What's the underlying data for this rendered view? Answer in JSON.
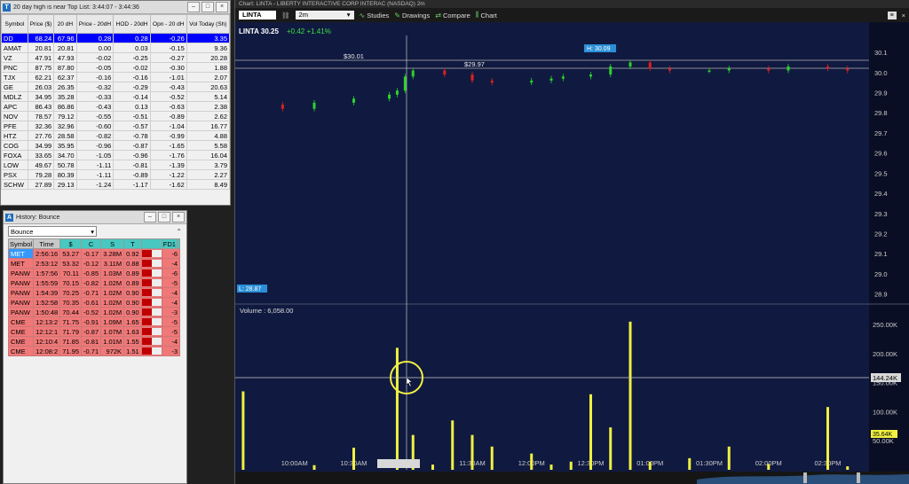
{
  "toplist": {
    "title": "20 day high is near Top List: 3:44:07 - 3:44:36",
    "icon": "T",
    "columns": [
      "Symbol",
      "Price ($)",
      "20 dH",
      "Price - 20dH",
      "HOD - 20dH",
      "Opn - 20 dH",
      "Vol Today (Sh)"
    ],
    "rows": [
      [
        "DD",
        "68.24",
        "67.96",
        "0.28",
        "0.28",
        "-0.26",
        "3.35"
      ],
      [
        "AMAT",
        "20.81",
        "20.81",
        "0.00",
        "0.03",
        "-0.15",
        "9.36"
      ],
      [
        "VZ",
        "47.91",
        "47.93",
        "-0.02",
        "-0.25",
        "-0.27",
        "20.28"
      ],
      [
        "PNC",
        "87.75",
        "87.80",
        "-0.05",
        "-0.02",
        "-0.30",
        "1.88"
      ],
      [
        "TJX",
        "62.21",
        "62.37",
        "-0.16",
        "-0.16",
        "-1.01",
        "2.07"
      ],
      [
        "GE",
        "26.03",
        "26.35",
        "-0.32",
        "-0.29",
        "-0.43",
        "20.63"
      ],
      [
        "MDLZ",
        "34.95",
        "35.28",
        "-0.33",
        "-0.14",
        "-0.52",
        "5.14"
      ],
      [
        "APC",
        "86.43",
        "86.86",
        "-0.43",
        "0.13",
        "-0.63",
        "2.38"
      ],
      [
        "NOV",
        "78.57",
        "79.12",
        "-0.55",
        "-0.51",
        "-0.89",
        "2.62"
      ],
      [
        "PFE",
        "32.36",
        "32.96",
        "-0.60",
        "-0.57",
        "-1.04",
        "16.77"
      ],
      [
        "HTZ",
        "27.76",
        "28.58",
        "-0.82",
        "-0.78",
        "-0.99",
        "4.88"
      ],
      [
        "COG",
        "34.99",
        "35.95",
        "-0.96",
        "-0.87",
        "-1.65",
        "5.58"
      ],
      [
        "FOXA",
        "33.65",
        "34.70",
        "-1.05",
        "-0.96",
        "-1.76",
        "16.04"
      ],
      [
        "LOW",
        "49.67",
        "50.78",
        "-1.11",
        "-0.81",
        "-1.39",
        "3.79"
      ],
      [
        "PSX",
        "79.28",
        "80.39",
        "-1.11",
        "-0.89",
        "-1.22",
        "2.27"
      ],
      [
        "SCHW",
        "27.89",
        "29.13",
        "-1.24",
        "-1.17",
        "-1.62",
        "8.49"
      ]
    ]
  },
  "history": {
    "title": "History: Bounce",
    "icon": "A",
    "selected": "Bounce",
    "columns": [
      "Symbol",
      "Time",
      "$",
      "C",
      "S",
      "T",
      "",
      "FD1",
      ""
    ],
    "rows": [
      [
        "MET",
        "2:56:16",
        "53.27",
        "-0.17",
        "3.28M",
        "0.92",
        "-6"
      ],
      [
        "MET",
        "2:53:12",
        "53.32",
        "-0.12",
        "3.11M",
        "0.88",
        "-4"
      ],
      [
        "PANW",
        "1:57:56",
        "70.11",
        "-0.85",
        "1.03M",
        "0.89",
        "-6"
      ],
      [
        "PANW",
        "1:55:59",
        "70.15",
        "-0.82",
        "1.02M",
        "0.89",
        "-5"
      ],
      [
        "PANW",
        "1:54:39",
        "70.25",
        "-0.71",
        "1.02M",
        "0.90",
        "-4"
      ],
      [
        "PANW",
        "1:52:58",
        "70.35",
        "-0.61",
        "1.02M",
        "0.90",
        "-4"
      ],
      [
        "PANW",
        "1:50:48",
        "70.44",
        "-0.52",
        "1.02M",
        "0.90",
        "-3"
      ],
      [
        "CME",
        "12:13:2",
        "71.75",
        "-0.91",
        "1.09M",
        "1.65",
        "-5"
      ],
      [
        "CME",
        "12:12:1",
        "71.79",
        "-0.87",
        "1.07M",
        "1.63",
        "-5"
      ],
      [
        "CME",
        "12:10:4",
        "71.85",
        "-0.81",
        "1.01M",
        "1.55",
        "-4"
      ],
      [
        "CME",
        "12:08:2",
        "71.95",
        "-0.71",
        "972K",
        "1.51",
        "-3"
      ]
    ]
  },
  "chart": {
    "window_title": "Chart: LINTA - LIBERTY INTERACTIVE CORP INTERAC (NASDAQ) 2m",
    "symbol": "LINTA",
    "timeframe": "2m",
    "toolbar": [
      "Studies",
      "Drawings",
      "Compare",
      "Chart"
    ],
    "quote": {
      "last": "LINTA 30.25",
      "change": "+0.42 +1.41%"
    },
    "price_levels": {
      "level1": "$30.01",
      "level2": "$29.97",
      "high_tag": "H: 30.09",
      "low_tag": "L: 28.87"
    },
    "volume": {
      "label": "Volume : 6,058.00",
      "cursor_value": "144.24K",
      "last_value": "35.64K"
    },
    "colors": {
      "background": "#101a40",
      "up": "#2bd32b",
      "down": "#e02020",
      "volume": "#f0f040",
      "quote": "#3ce03c"
    }
  },
  "chart_data": [
    {
      "type": "candlestick",
      "title": "LINTA 30.25",
      "x_ticks": [
        "10:00AM",
        "10:30AM",
        "10:52AM",
        "11:30AM",
        "12:00PM",
        "12:30PM",
        "01:00PM",
        "01:30PM",
        "02:00PM",
        "02:30PM"
      ],
      "y_ticks": [
        30.1,
        30.0,
        29.9,
        29.8,
        29.7,
        29.6,
        29.5,
        29.4,
        29.3,
        29.2,
        29.1,
        29.0,
        28.9
      ],
      "ylim": [
        28.85,
        30.14
      ],
      "x": [
        "09:32",
        "09:54",
        "10:10",
        "10:30",
        "10:48",
        "10:52",
        "10:56",
        "11:00",
        "11:16",
        "11:30",
        "11:40",
        "12:00",
        "12:10",
        "12:16",
        "12:30",
        "12:40",
        "12:50",
        "13:00",
        "13:10",
        "13:30",
        "13:40",
        "14:00",
        "14:10",
        "14:30",
        "14:40"
      ],
      "close": [
        29.84,
        29.82,
        29.85,
        29.87,
        29.89,
        29.91,
        29.98,
        30.01,
        29.99,
        29.96,
        29.95,
        29.96,
        29.97,
        29.98,
        29.99,
        30.03,
        30.05,
        30.02,
        30.01,
        30.01,
        30.02,
        30.01,
        30.03,
        30.02,
        30.01
      ]
    },
    {
      "type": "bar",
      "title": "Volume : 6,058.00",
      "y_ticks": [
        "250.00K",
        "200.00K",
        "150.00K",
        "100.00K",
        "50.00K"
      ],
      "ylim": [
        0,
        270000
      ],
      "x": [
        "09:34",
        "10:10",
        "10:30",
        "10:52",
        "11:00",
        "11:10",
        "11:20",
        "11:30",
        "11:40",
        "12:00",
        "12:10",
        "12:20",
        "12:30",
        "12:40",
        "12:50",
        "13:00",
        "13:20",
        "13:40",
        "14:00",
        "14:30",
        "14:40"
      ],
      "values": [
        135000,
        8000,
        38000,
        210000,
        60000,
        9000,
        85000,
        60000,
        40000,
        28000,
        9000,
        14000,
        130000,
        73000,
        255000,
        14000,
        20000,
        40000,
        10000,
        108000,
        6000
      ]
    }
  ]
}
